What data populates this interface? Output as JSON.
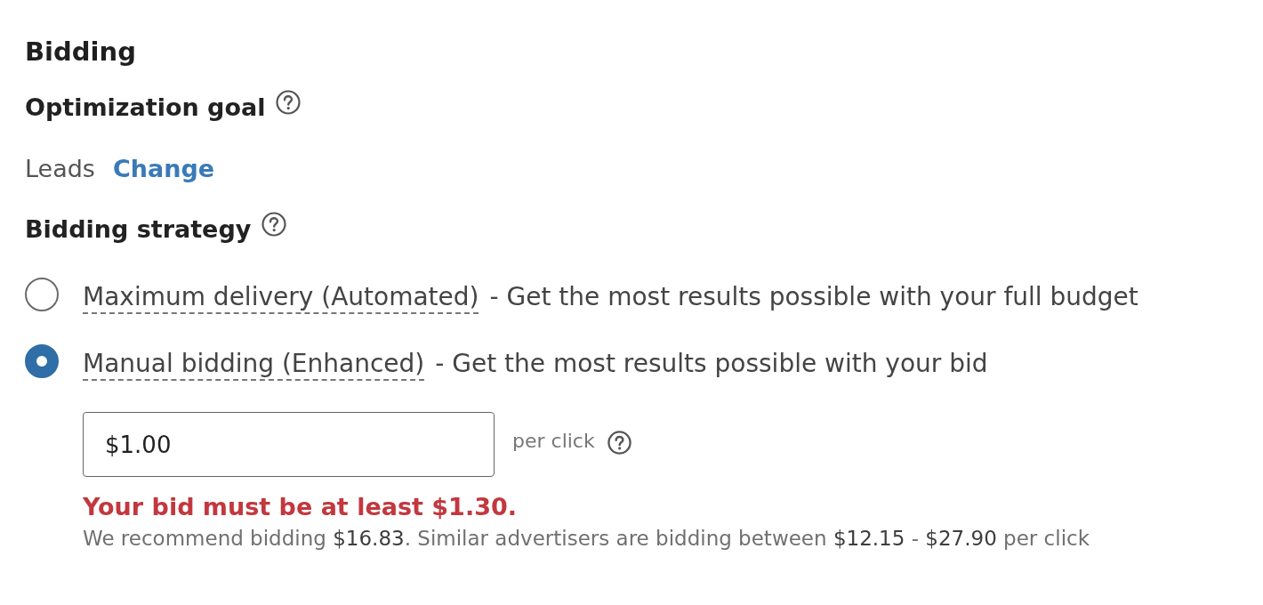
{
  "section": {
    "title": "Bidding"
  },
  "optimization_goal": {
    "label": "Optimization goal",
    "value": "Leads",
    "change_link": "Change"
  },
  "bidding_strategy": {
    "label": "Bidding strategy",
    "options": [
      {
        "term": "Maximum delivery (Automated)",
        "description": "- Get the most results possible with your full budget",
        "selected": false
      },
      {
        "term": "Manual bidding (Enhanced)",
        "description": "- Get the most results possible with your bid",
        "selected": true
      }
    ]
  },
  "bid": {
    "value": "$1.00",
    "unit": "per click",
    "error": "Your bid must be at least $1.30.",
    "recommendation": "We recommend bidding **$16.83**. Similar advertisers are bidding between **$12.15** - **$27.90** per click"
  }
}
